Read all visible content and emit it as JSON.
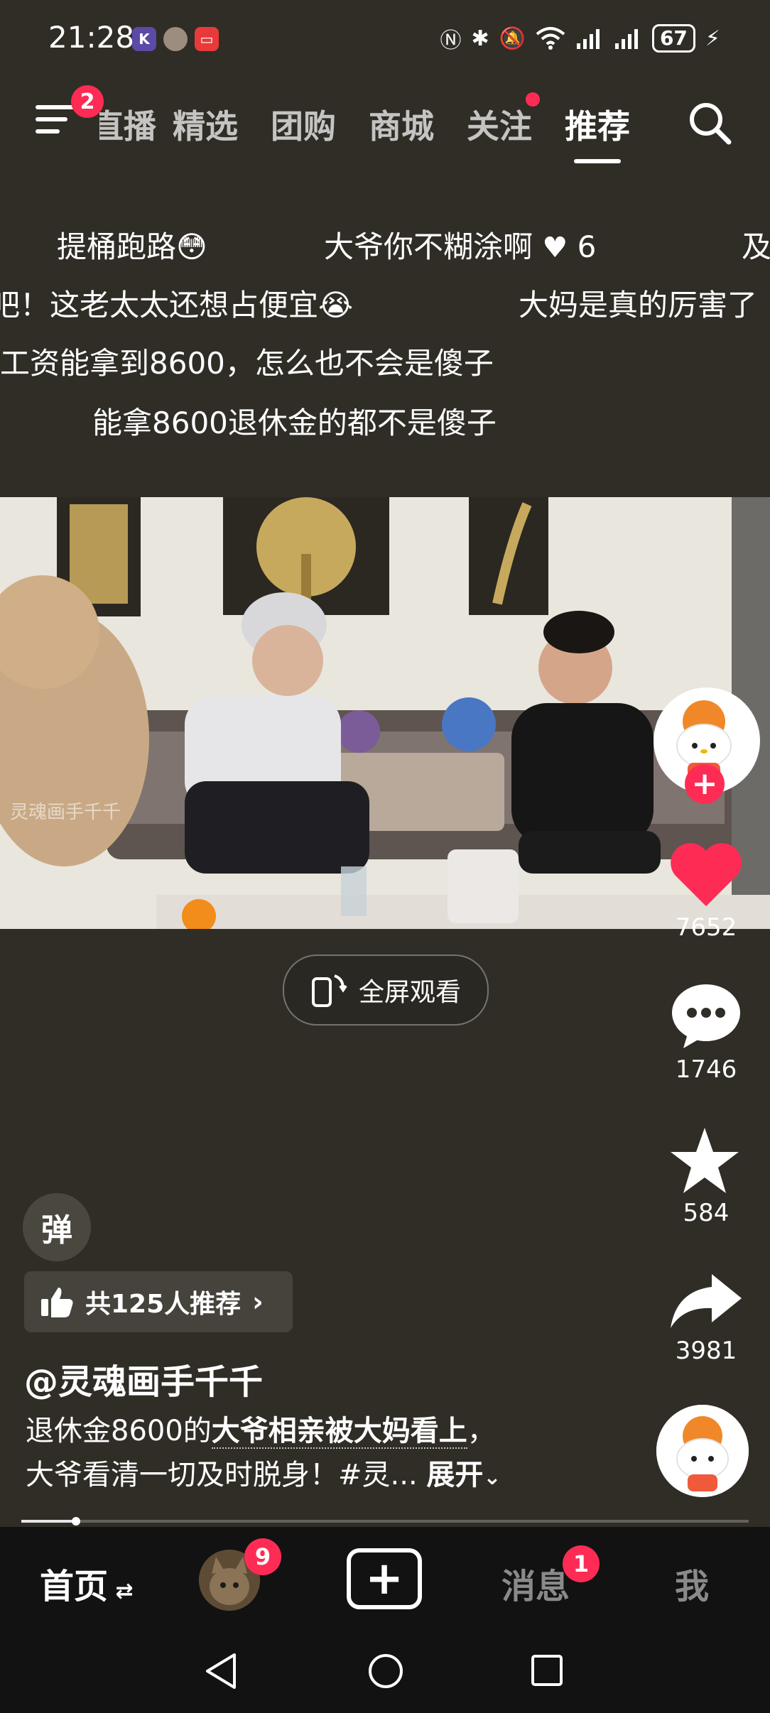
{
  "status_bar": {
    "time": "21:28",
    "app_icons": [
      "K",
      "",
      "▭"
    ],
    "battery": "67"
  },
  "top_nav": {
    "menu_badge": "2",
    "tabs": [
      {
        "label": "直播"
      },
      {
        "label": "精选"
      },
      {
        "label": "团购"
      },
      {
        "label": "商城"
      },
      {
        "label": "关注"
      },
      {
        "label": "推荐"
      }
    ],
    "active_tab": "推荐",
    "search_icon": "search-icon"
  },
  "danmaku": {
    "row1a": "提桶跑路😳",
    "row1b": "大爷你不糊涂啊",
    "row1b_likes": "6",
    "row1c": "及",
    "row2a": "吧！这老太太还想占便宜😭",
    "row2b": "大妈是真的厉害了",
    "row3": "工资能拿到8600，怎么也不会是傻子",
    "row4": "能拿8600退休金的都不是傻子"
  },
  "video": {
    "watermark": "灵魂画手千千",
    "fullscreen_label": "全屏观看"
  },
  "actions": {
    "likes": "7652",
    "comments": "1746",
    "favorites": "584",
    "shares": "3981"
  },
  "overlay": {
    "danmaku_toggle": "弹",
    "recommend_chip": "共125人推荐"
  },
  "post": {
    "author": "@灵魂画手千千",
    "desc_prefix": "退休金8600的",
    "desc_highlight": "大爷相亲被大妈看上",
    "desc_comma": "，",
    "desc_line2": "大爷看清一切及时脱身！#灵...",
    "expand": "展开"
  },
  "progress": 0.075,
  "bottom_tabs": {
    "home": "首页",
    "friends_badge": "9",
    "create": "+",
    "messages": "消息",
    "messages_badge": "1",
    "me": "我"
  },
  "colors": {
    "background": "#2f2d26",
    "accent": "#fe2c55",
    "tabbar": "#121212"
  }
}
